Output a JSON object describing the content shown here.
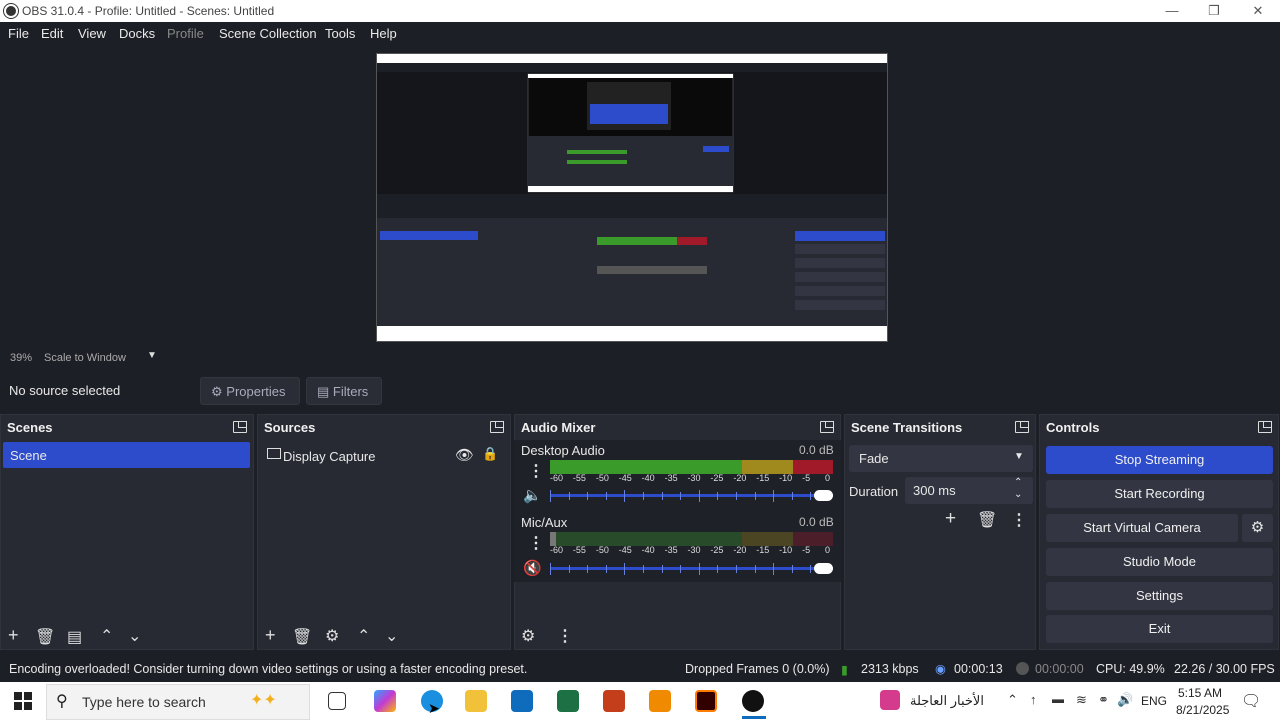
{
  "window": {
    "title": "OBS 31.0.4 - Profile: Untitled - Scenes: Untitled"
  },
  "menu": [
    "File",
    "Edit",
    "View",
    "Docks",
    "Profile",
    "Scene Collection",
    "Tools",
    "Help"
  ],
  "preview": {
    "zoom": "39%",
    "scale_mode": "Scale to Window"
  },
  "source_toolbar": {
    "no_source": "No source selected",
    "properties": "Properties",
    "filters": "Filters"
  },
  "scenes": {
    "title": "Scenes",
    "items": [
      "Scene"
    ]
  },
  "sources": {
    "title": "Sources",
    "items": [
      "Display Capture"
    ]
  },
  "mixer": {
    "title": "Audio Mixer",
    "channels": [
      {
        "name": "Desktop Audio",
        "db": "0.0 dB",
        "level": 1.0,
        "muted": false
      },
      {
        "name": "Mic/Aux",
        "db": "0.0 dB",
        "level": 0.02,
        "muted": true
      }
    ],
    "scale": [
      "-60",
      "-55",
      "-50",
      "-45",
      "-40",
      "-35",
      "-30",
      "-25",
      "-20",
      "-15",
      "-10",
      "-5",
      "0"
    ]
  },
  "transitions": {
    "title": "Scene Transitions",
    "selected": "Fade",
    "duration_label": "Duration",
    "duration_value": "300 ms"
  },
  "controls": {
    "title": "Controls",
    "stop_streaming": "Stop Streaming",
    "start_recording": "Start Recording",
    "start_virtual_camera": "Start Virtual Camera",
    "studio_mode": "Studio Mode",
    "settings": "Settings",
    "exit": "Exit"
  },
  "status": {
    "message": "Encoding overloaded! Consider turning down video settings or using a faster encoding preset.",
    "dropped": "Dropped Frames 0 (0.0%)",
    "bitrate": "2313 kbps",
    "stream_time": "00:00:13",
    "rec_time": "00:00:00",
    "cpu": "CPU: 49.9%",
    "fps": "22.26 / 30.00 FPS"
  },
  "taskbar": {
    "search_placeholder": "Type here to search",
    "news": "الأخبار العاجلة",
    "lang": "ENG",
    "time": "5:15 AM",
    "date": "8/21/2025"
  },
  "colors": {
    "accent": "#2d4ccc",
    "meter_green": "#3a9b2a",
    "meter_yellow": "#a08a1e",
    "meter_red": "#a01a2a"
  }
}
